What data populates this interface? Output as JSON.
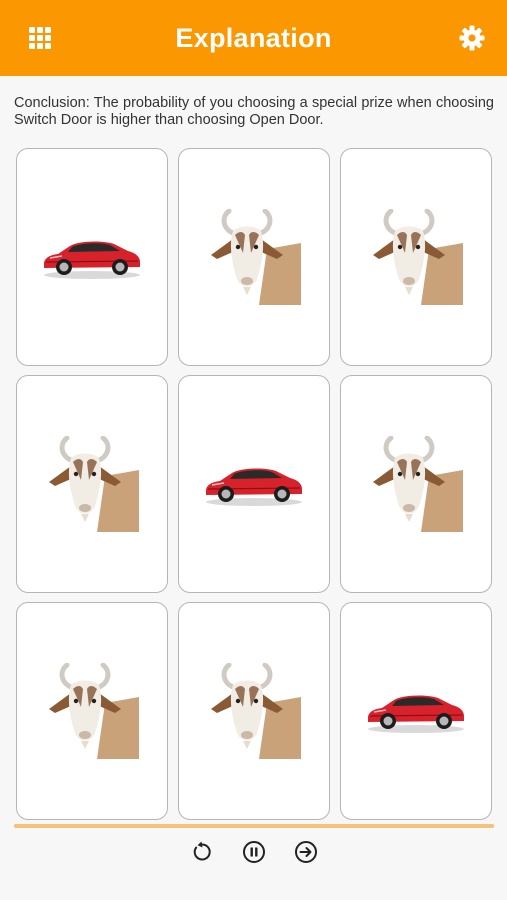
{
  "header": {
    "title": "Explanation",
    "menu_icon": "grid-menu-icon",
    "settings_icon": "gear-icon"
  },
  "conclusion": "Conclusion: The probability of you choosing a special prize when choosing Switch Door is higher than choosing Open Door.",
  "cards": [
    {
      "prize": "car"
    },
    {
      "prize": "goat"
    },
    {
      "prize": "goat"
    },
    {
      "prize": "goat"
    },
    {
      "prize": "car"
    },
    {
      "prize": "goat"
    },
    {
      "prize": "goat"
    },
    {
      "prize": "goat"
    },
    {
      "prize": "car"
    }
  ],
  "progress": 1.0,
  "controls": {
    "restart_icon": "restart-icon",
    "pause_icon": "pause-icon",
    "next_icon": "next-icon"
  },
  "colors": {
    "accent": "#fb9700",
    "progress": "#f5c27a",
    "car_red": "#d8222b"
  }
}
